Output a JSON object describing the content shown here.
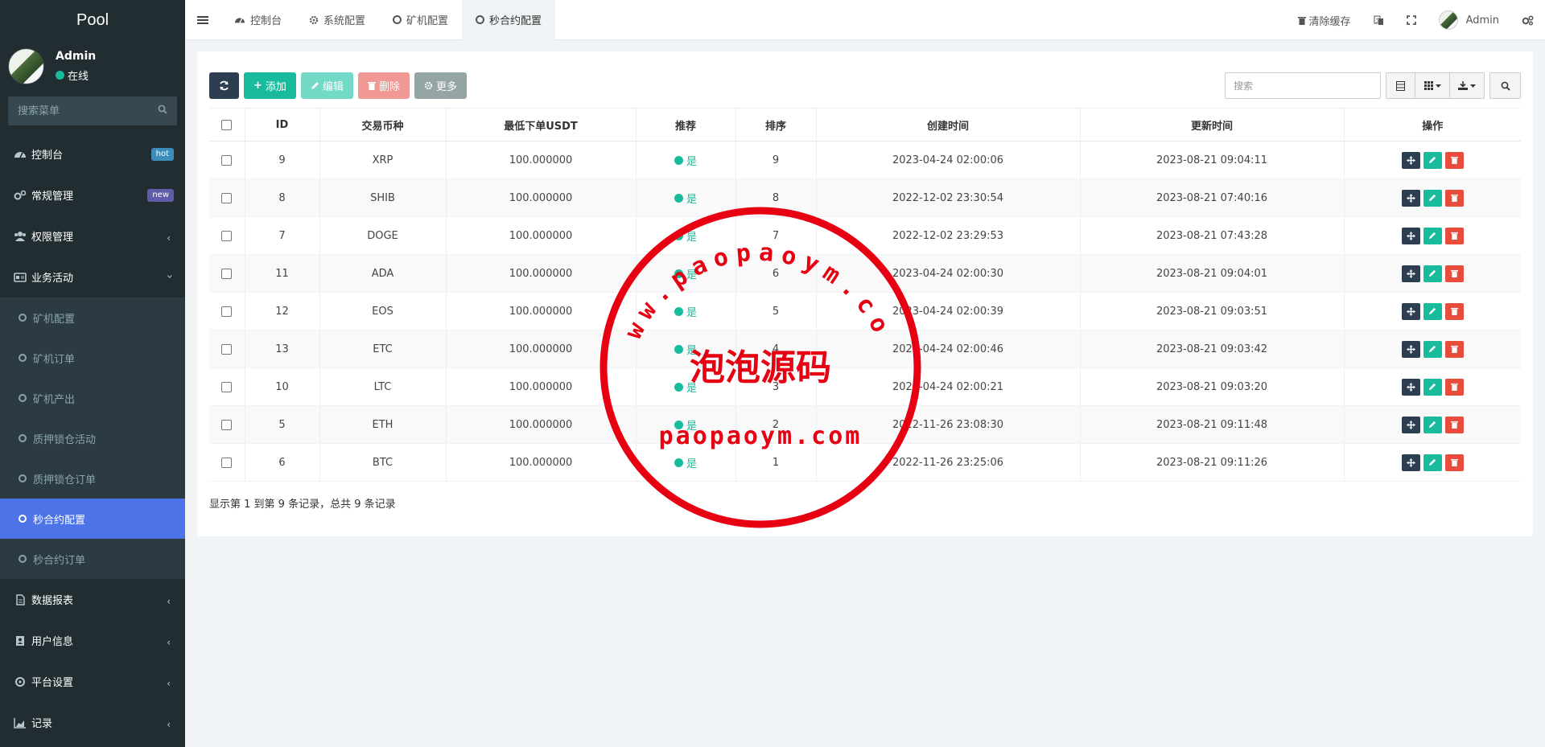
{
  "sidebar": {
    "logo": "Pool",
    "user": {
      "name": "Admin",
      "status": "在线"
    },
    "search_placeholder": "搜索菜单",
    "items": [
      {
        "label": "控制台",
        "badge": "hot",
        "badge_color": "#3c8dbc"
      },
      {
        "label": "常规管理",
        "badge": "new",
        "badge_color": "#605ca8"
      },
      {
        "label": "权限管理"
      },
      {
        "label": "业务活动"
      },
      {
        "label": "数据报表"
      },
      {
        "label": "用户信息"
      },
      {
        "label": "平台设置"
      },
      {
        "label": "记录"
      }
    ],
    "submenu": [
      {
        "label": "矿机配置"
      },
      {
        "label": "矿机订单"
      },
      {
        "label": "矿机产出"
      },
      {
        "label": "质押锁仓活动"
      },
      {
        "label": "质押锁仓订单"
      },
      {
        "label": "秒合约配置",
        "active": true
      },
      {
        "label": "秒合约订单"
      }
    ]
  },
  "topbar": {
    "tabs": [
      {
        "label": "控制台"
      },
      {
        "label": "系统配置"
      },
      {
        "label": "矿机配置"
      },
      {
        "label": "秒合约配置",
        "active": true
      }
    ],
    "clear_cache": "清除缓存",
    "admin": "Admin"
  },
  "toolbar": {
    "add": "添加",
    "edit": "编辑",
    "delete": "删除",
    "more": "更多",
    "search_placeholder": "搜索"
  },
  "table": {
    "headers": [
      "ID",
      "交易币种",
      "最低下单USDT",
      "推荐",
      "排序",
      "创建时间",
      "更新时间",
      "操作"
    ],
    "rows": [
      {
        "id": "9",
        "coin": "XRP",
        "min": "100.000000",
        "rec": "是",
        "sort": "9",
        "created": "2023-04-24 02:00:06",
        "updated": "2023-08-21 09:04:11"
      },
      {
        "id": "8",
        "coin": "SHIB",
        "min": "100.000000",
        "rec": "是",
        "sort": "8",
        "created": "2022-12-02 23:30:54",
        "updated": "2023-08-21 07:40:16"
      },
      {
        "id": "7",
        "coin": "DOGE",
        "min": "100.000000",
        "rec": "是",
        "sort": "7",
        "created": "2022-12-02 23:29:53",
        "updated": "2023-08-21 07:43:28"
      },
      {
        "id": "11",
        "coin": "ADA",
        "min": "100.000000",
        "rec": "是",
        "sort": "6",
        "created": "2023-04-24 02:00:30",
        "updated": "2023-08-21 09:04:01"
      },
      {
        "id": "12",
        "coin": "EOS",
        "min": "100.000000",
        "rec": "是",
        "sort": "5",
        "created": "2023-04-24 02:00:39",
        "updated": "2023-08-21 09:03:51"
      },
      {
        "id": "13",
        "coin": "ETC",
        "min": "100.000000",
        "rec": "是",
        "sort": "4",
        "created": "2023-04-24 02:00:46",
        "updated": "2023-08-21 09:03:42"
      },
      {
        "id": "10",
        "coin": "LTC",
        "min": "100.000000",
        "rec": "是",
        "sort": "3",
        "created": "2023-04-24 02:00:21",
        "updated": "2023-08-21 09:03:20"
      },
      {
        "id": "5",
        "coin": "ETH",
        "min": "100.000000",
        "rec": "是",
        "sort": "2",
        "created": "2022-11-26 23:08:30",
        "updated": "2023-08-21 09:11:48"
      },
      {
        "id": "6",
        "coin": "BTC",
        "min": "100.000000",
        "rec": "是",
        "sort": "1",
        "created": "2022-11-26 23:25:06",
        "updated": "2023-08-21 09:11:26"
      }
    ]
  },
  "pagination": "显示第 1 到第 9 条记录，总共 9 条记录",
  "watermark": {
    "top": "www.paopaoym.com",
    "middle": "泡泡源码",
    "bottom": "paopaoym.com"
  }
}
